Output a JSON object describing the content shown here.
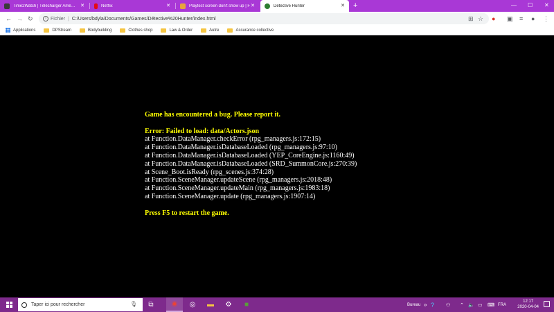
{
  "browser": {
    "tabs": [
      {
        "label": "Time2Watch | Télécharger Améric",
        "favicon_color": "#3a3a3a",
        "active": false
      },
      {
        "label": "Netflix",
        "favicon_color": "#e50914",
        "active": false
      },
      {
        "label": "Playtest screen don't show up | F",
        "favicon_color": "#e8a33c",
        "active": false
      },
      {
        "label": "Detective Hunter",
        "favicon_color": "#2e7d32",
        "active": true
      }
    ],
    "new_tab_label": "+",
    "window_controls": {
      "minimize": "—",
      "maximize": "☐",
      "close": "✕"
    },
    "address": {
      "security_label": "Fichier",
      "url": "C:/Users/bdyla/Documents/Games/Détective%20Hunter/index.html"
    },
    "bookmarks": [
      {
        "label": "Applications",
        "icon": "apps-grid-icon"
      },
      {
        "label": "DPStream",
        "icon": "folder-icon"
      },
      {
        "label": "Bodybuilding",
        "icon": "folder-icon"
      },
      {
        "label": "Clothes shop",
        "icon": "folder-icon"
      },
      {
        "label": "Law & Order",
        "icon": "folder-icon"
      },
      {
        "label": "Autre",
        "icon": "folder-icon"
      },
      {
        "label": "Assurance collective",
        "icon": "folder-icon"
      }
    ]
  },
  "game": {
    "headline": "Game has encountered a bug. Please report it.",
    "error_title": "Error: Failed to load: data/Actors.json",
    "stack": [
      "at Function.DataManager.checkError (rpg_managers.js:172:15)",
      "at Function.DataManager.isDatabaseLoaded (rpg_managers.js:97:10)",
      "at Function.DataManager.isDatabaseLoaded (YEP_CoreEngine.js:1160:49)",
      "at Function.DataManager.isDatabaseLoaded (SRD_SummonCore.js:270:39)",
      "at Scene_Boot.isReady (rpg_scenes.js:374:28)",
      "at Function.SceneManager.updateScene (rpg_managers.js:2018:48)",
      "at Function.SceneManager.updateMain (rpg_managers.js:1983:18)",
      "at Function.SceneManager.update (rpg_managers.js:1907:14)"
    ],
    "restart_hint": "Press F5 to restart the game."
  },
  "taskbar": {
    "search_placeholder": "Taper ici pour rechercher",
    "tray_label": "Bureau",
    "language": "FRA",
    "time": "12:17",
    "date": "2020-04-04"
  },
  "colors": {
    "tabstrip": "#a938d6",
    "taskbar": "#7e2a8c",
    "error_yellow": "#ffff00",
    "error_white": "#ffffff"
  }
}
